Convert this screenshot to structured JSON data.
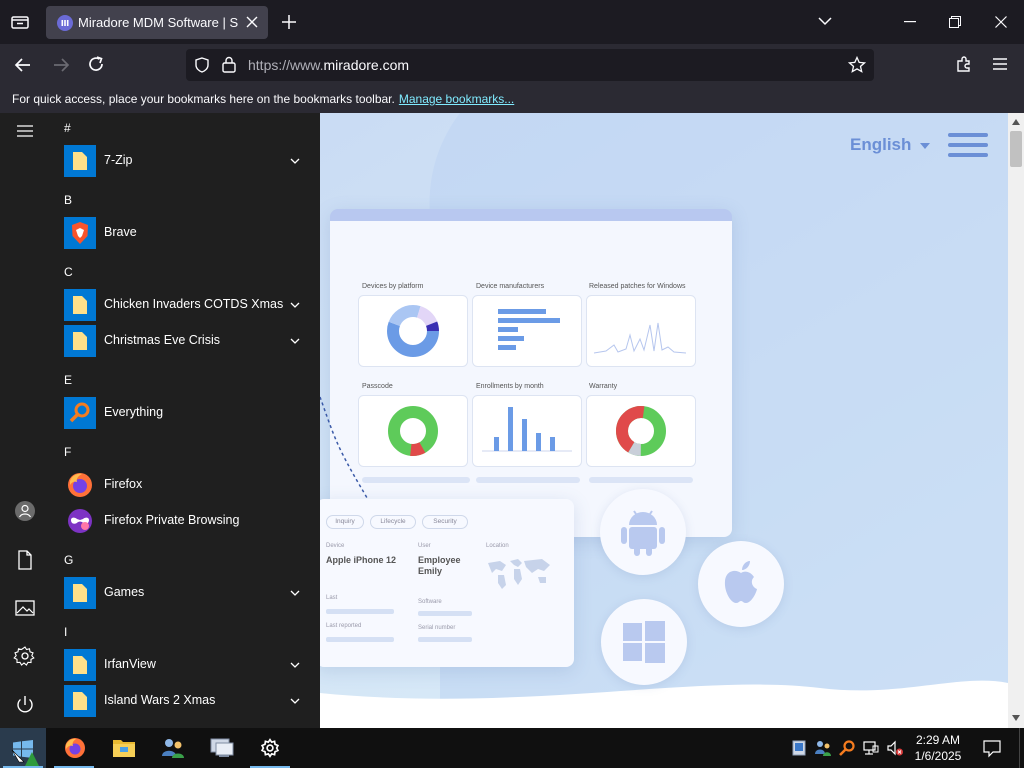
{
  "browser": {
    "tab_title": "Miradore MDM Software | Smart",
    "url_prefix": "https://www.",
    "url_domain": "miradore.com",
    "bookmarks_hint": "For quick access, place your bookmarks here on the bookmarks toolbar.",
    "bookmarks_link": "Manage bookmarks..."
  },
  "webpage": {
    "language": "English",
    "dashboard": {
      "cards": [
        "Devices by platform",
        "Device manufacturers",
        "Released patches for Windows",
        "Passcode",
        "Enrollments by month",
        "Warranty"
      ]
    },
    "device_card": {
      "tags": [
        "Inquiry",
        "Lifecycle",
        "Security"
      ],
      "device_label": "Device",
      "device_value": "Apple iPhone 12",
      "user_label": "User",
      "user_value_line1": "Employee",
      "user_value_line2": "Emily",
      "location_label": "Location",
      "last_label": "Last",
      "last_reported_label": "Last reported",
      "software_label": "Software",
      "serial_label": "Serial number"
    },
    "platform_icons": [
      "android-icon",
      "apple-icon",
      "windows-icon"
    ]
  },
  "start_menu": {
    "sections": [
      {
        "letter": "#",
        "apps": [
          {
            "label": "7-Zip",
            "icon": "folder-icon",
            "expandable": true
          }
        ]
      },
      {
        "letter": "B",
        "apps": [
          {
            "label": "Brave",
            "icon": "brave-icon",
            "expandable": false
          }
        ]
      },
      {
        "letter": "C",
        "apps": [
          {
            "label": "Chicken Invaders COTDS Xmas",
            "icon": "folder-icon",
            "expandable": true
          },
          {
            "label": "Christmas Eve Crisis",
            "icon": "folder-icon",
            "expandable": true
          }
        ]
      },
      {
        "letter": "E",
        "apps": [
          {
            "label": "Everything",
            "icon": "search-app-icon",
            "expandable": false
          }
        ]
      },
      {
        "letter": "F",
        "apps": [
          {
            "label": "Firefox",
            "icon": "firefox-icon",
            "expandable": false
          },
          {
            "label": "Firefox Private Browsing",
            "icon": "firefox-private-icon",
            "expandable": false
          }
        ]
      },
      {
        "letter": "G",
        "apps": [
          {
            "label": "Games",
            "icon": "folder-icon",
            "expandable": true
          }
        ]
      },
      {
        "letter": "I",
        "apps": [
          {
            "label": "IrfanView",
            "icon": "folder-icon",
            "expandable": true
          },
          {
            "label": "Island Wars 2 Xmas",
            "icon": "folder-icon",
            "expandable": true
          }
        ]
      }
    ]
  },
  "taskbar": {
    "apps": [
      "start-button",
      "firefox",
      "file-explorer",
      "network-app",
      "remote-desktop",
      "settings"
    ],
    "time": "2:29 AM",
    "date": "1/6/2025"
  },
  "colors": {
    "accent": "#76b9ed",
    "chart_blue": "#6b9be6",
    "chart_green": "#5ecb5a",
    "chart_red": "#e04a4a",
    "page_bg": "#cfe0f5"
  }
}
